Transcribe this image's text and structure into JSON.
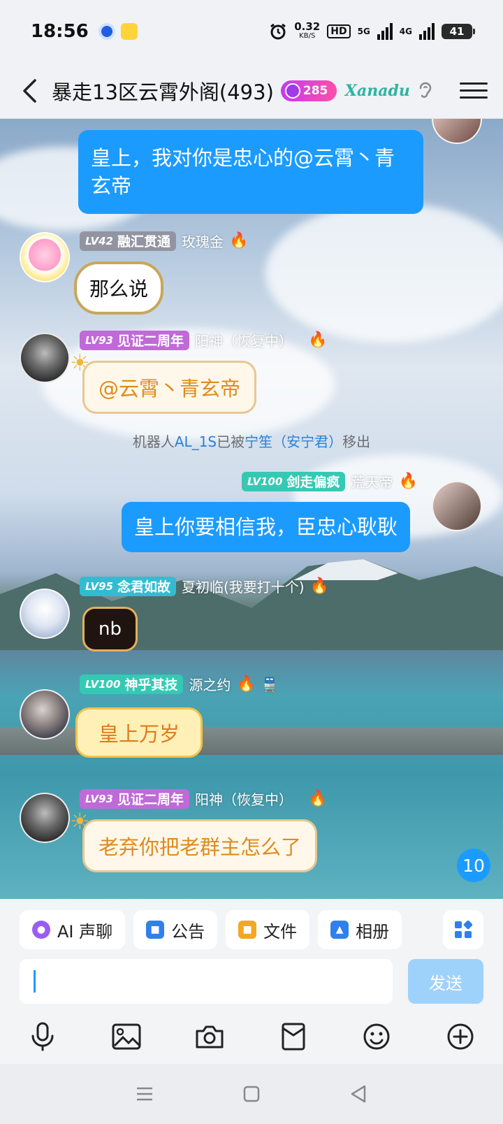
{
  "status_bar": {
    "time": "18:56",
    "net_speed": "0.32",
    "net_unit": "KB/S",
    "hd": "HD",
    "sig1": "5G",
    "sig2": "4G",
    "battery": "41"
  },
  "header": {
    "title": "暴走13区云霄外阁(493)",
    "fire_count": "285",
    "brand": "Xanadu",
    "icons": [
      "back-arrow-icon",
      "ear-icon",
      "menu-icon"
    ]
  },
  "chat": {
    "messages": [
      {
        "side": "right",
        "text": "皇上，我对你是忠心的@云霄丶青玄帝"
      },
      {
        "side": "left",
        "level": "LV42",
        "badge": "融汇贯通",
        "nickname": "玫瑰金",
        "text": "那么说"
      },
      {
        "side": "left",
        "level": "LV93",
        "badge": "见证二周年",
        "nickname": "阳神（恢复中）",
        "text": "@云霄丶青玄帝"
      },
      {
        "side": "right",
        "level": "LV100",
        "badge": "剑走偏疯",
        "nickname": "荒天帝",
        "text": "皇上你要相信我，臣忠心耿耿"
      },
      {
        "side": "left",
        "level": "LV95",
        "badge": "念君如故",
        "nickname": "夏初临(我要打十个)",
        "text": "nb"
      },
      {
        "side": "left",
        "level": "LV100",
        "badge": "神乎其技",
        "nickname": "源之约",
        "text": "皇上万岁"
      },
      {
        "side": "left",
        "level": "LV93",
        "badge": "见证二周年",
        "nickname": "阳神（恢复中）",
        "text": "老弃你把老群主怎么了"
      }
    ],
    "system": {
      "prefix": "机器人",
      "bot": "AL_1S",
      "mid": "已被",
      "actor": "宁笙（安宁君）",
      "suffix": "移出"
    },
    "unread_count": "10"
  },
  "bottom": {
    "quick_actions": [
      "AI 声聊",
      "公告",
      "文件",
      "相册"
    ],
    "input_value": "",
    "send_label": "发送",
    "tools": [
      "microphone-icon",
      "image-icon",
      "camera-icon",
      "red-packet-icon",
      "emoji-icon",
      "plus-icon"
    ]
  },
  "colors": {
    "accent": "#1c9bff",
    "send_disabled": "#9fd2fb",
    "system_link": "#2f7fd6"
  }
}
